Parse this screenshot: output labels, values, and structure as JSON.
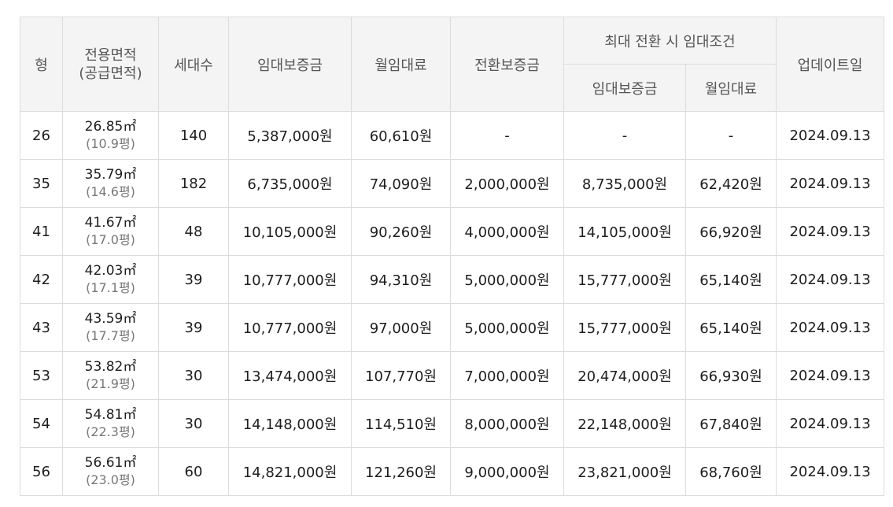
{
  "headers": {
    "type": "형",
    "area_line1": "전용면적",
    "area_line2": "(공급면적)",
    "households": "세대수",
    "deposit": "임대보증금",
    "monthly_rent": "월임대료",
    "conversion_deposit": "전환보증금",
    "max_conversion_group": "최대 전환 시 임대조건",
    "max_deposit": "임대보증금",
    "max_monthly_rent": "월임대료",
    "updated": "업데이트일"
  },
  "rows": [
    {
      "type": "26",
      "area": "26.85㎡",
      "supply_area": "(10.9평)",
      "households": "140",
      "deposit": "5,387,000원",
      "monthly_rent": "60,610원",
      "conversion_deposit": "-",
      "max_deposit": "-",
      "max_monthly_rent": "-",
      "updated": "2024.09.13"
    },
    {
      "type": "35",
      "area": "35.79㎡",
      "supply_area": "(14.6평)",
      "households": "182",
      "deposit": "6,735,000원",
      "monthly_rent": "74,090원",
      "conversion_deposit": "2,000,000원",
      "max_deposit": "8,735,000원",
      "max_monthly_rent": "62,420원",
      "updated": "2024.09.13"
    },
    {
      "type": "41",
      "area": "41.67㎡",
      "supply_area": "(17.0평)",
      "households": "48",
      "deposit": "10,105,000원",
      "monthly_rent": "90,260원",
      "conversion_deposit": "4,000,000원",
      "max_deposit": "14,105,000원",
      "max_monthly_rent": "66,920원",
      "updated": "2024.09.13"
    },
    {
      "type": "42",
      "area": "42.03㎡",
      "supply_area": "(17.1평)",
      "households": "39",
      "deposit": "10,777,000원",
      "monthly_rent": "94,310원",
      "conversion_deposit": "5,000,000원",
      "max_deposit": "15,777,000원",
      "max_monthly_rent": "65,140원",
      "updated": "2024.09.13"
    },
    {
      "type": "43",
      "area": "43.59㎡",
      "supply_area": "(17.7평)",
      "households": "39",
      "deposit": "10,777,000원",
      "monthly_rent": "97,000원",
      "conversion_deposit": "5,000,000원",
      "max_deposit": "15,777,000원",
      "max_monthly_rent": "65,140원",
      "updated": "2024.09.13"
    },
    {
      "type": "53",
      "area": "53.82㎡",
      "supply_area": "(21.9평)",
      "households": "30",
      "deposit": "13,474,000원",
      "monthly_rent": "107,770원",
      "conversion_deposit": "7,000,000원",
      "max_deposit": "20,474,000원",
      "max_monthly_rent": "66,930원",
      "updated": "2024.09.13"
    },
    {
      "type": "54",
      "area": "54.81㎡",
      "supply_area": "(22.3평)",
      "households": "30",
      "deposit": "14,148,000원",
      "monthly_rent": "114,510원",
      "conversion_deposit": "8,000,000원",
      "max_deposit": "22,148,000원",
      "max_monthly_rent": "67,840원",
      "updated": "2024.09.13"
    },
    {
      "type": "56",
      "area": "56.61㎡",
      "supply_area": "(23.0평)",
      "households": "60",
      "deposit": "14,821,000원",
      "monthly_rent": "121,260원",
      "conversion_deposit": "9,000,000원",
      "max_deposit": "23,821,000원",
      "max_monthly_rent": "68,760원",
      "updated": "2024.09.13"
    }
  ],
  "colors": {
    "header_bg": "#f4f4f4",
    "border": "#dcdcdc",
    "header_text": "#555555",
    "body_text": "#1e1e1e",
    "sub_text": "#777777"
  }
}
